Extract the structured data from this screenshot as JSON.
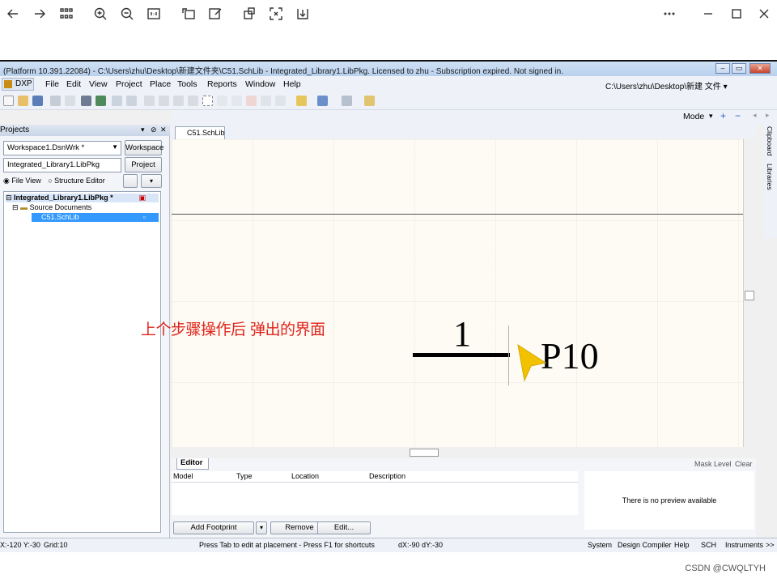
{
  "viewer": {
    "icons": [
      "back-icon",
      "forward-icon",
      "grid-icon",
      "zoom-in-icon",
      "zoom-out-icon",
      "actual-size-icon",
      "rotate-icon",
      "edit-icon",
      "crop-icon",
      "fullscreen-icon",
      "download-icon",
      "more-icon",
      "minimize-icon",
      "maximize-icon",
      "close-icon"
    ]
  },
  "app": {
    "title": "(Platform 10.391.22084) - C:\\Users\\zhu\\Desktop\\新建文件夹\\C51.SchLib - Integrated_Library1.LibPkg. Licensed to zhu - Subscription expired. Not signed in.",
    "dxp_label": "DXP",
    "menu": [
      "File",
      "Edit",
      "View",
      "Project",
      "Place",
      "Tools",
      "Reports",
      "Window",
      "Help"
    ],
    "path": "C:\\Users\\zhu\\Desktop\\新建 文件 ▾",
    "mode_label": "Mode"
  },
  "projects": {
    "title": "Projects",
    "workspace_value": "Workspace1.DsnWrk *",
    "workspace_button": "Workspace",
    "project_value": "Integrated_Library1.LibPkg",
    "project_button": "Project",
    "view_options": [
      "File View",
      "Structure Editor"
    ],
    "tree": [
      "Integrated_Library1.LibPkg *",
      "Source Documents",
      "C51.SchLib"
    ]
  },
  "document": {
    "tab_label": "C51.SchLib",
    "pin_number": "1",
    "pin_name": "P10"
  },
  "side_tabs": [
    "Clipboard",
    "Libraries"
  ],
  "editor": {
    "tab_label": "Editor",
    "mask_level": "Mask Level",
    "clear": "Clear",
    "columns": [
      "Model",
      "Type",
      "Location",
      "Description"
    ],
    "preview_text": "There is no preview available",
    "buttons": [
      "Add Footprint",
      "Remove",
      "Edit..."
    ]
  },
  "status": {
    "coords": "X:-120 Y:-30",
    "grid": "Grid:10",
    "hint": "Press Tab to edit at placement - Press F1 for shortcuts",
    "delta": "dX:-90 dY:-30",
    "panels": [
      "System",
      "Design Compiler",
      "Help",
      "SCH",
      "Instruments",
      ">>"
    ]
  },
  "annotation": "上个步骤操作后 弹出的界面",
  "watermark": "CSDN @CWQLTYH",
  "colors": {
    "annotation": "#e0231c",
    "cursor": "#f2c200",
    "selection": "#3399ff"
  }
}
